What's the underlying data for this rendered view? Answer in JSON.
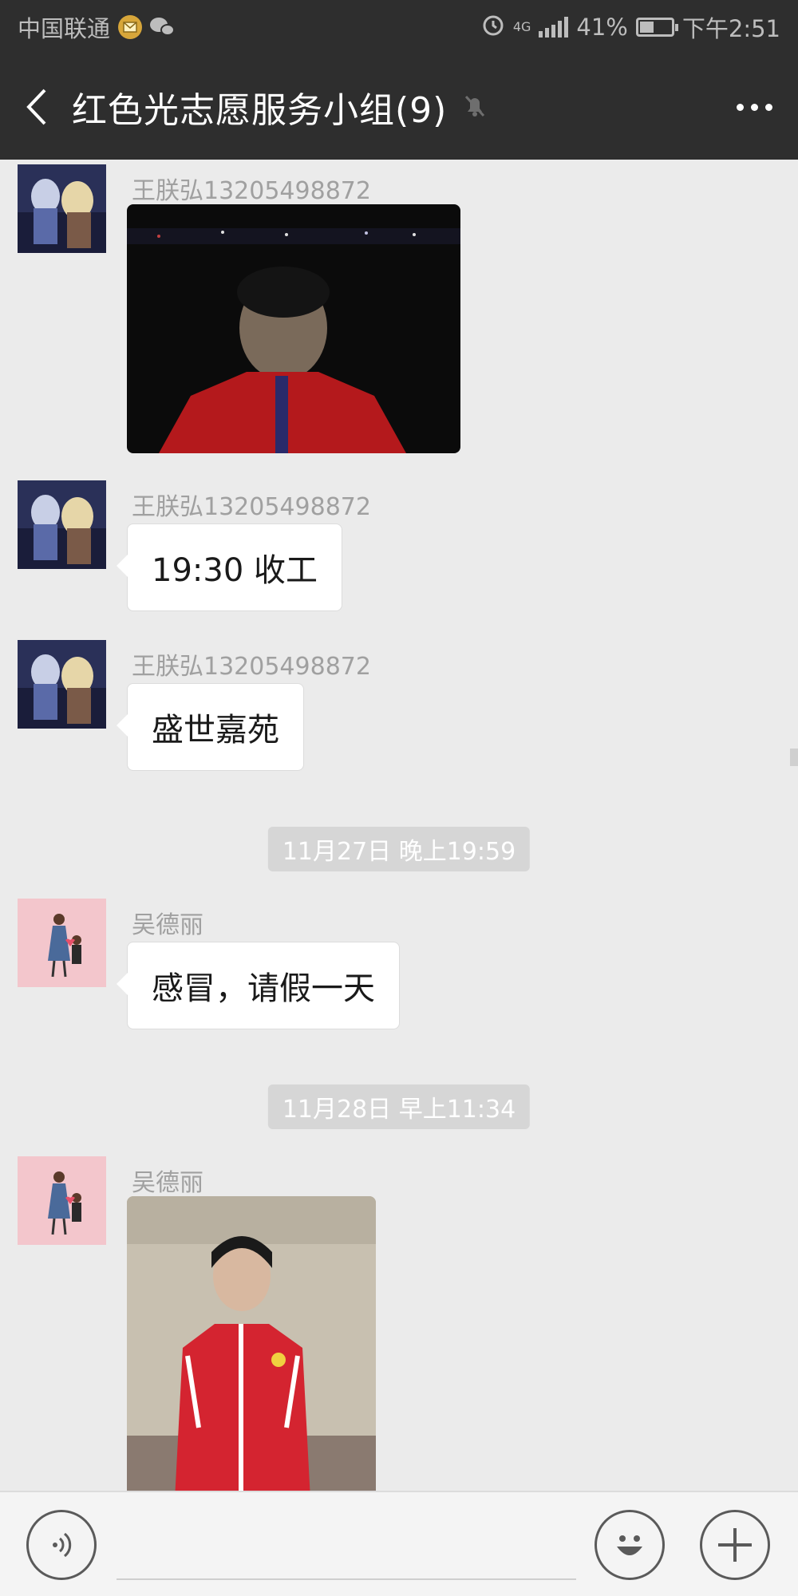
{
  "status_bar": {
    "carrier": "中国联通",
    "network": "4G",
    "battery_percent": "41%",
    "time": "下午2:51",
    "battery_level": 0.41
  },
  "header": {
    "title": "红色光志愿服务小组(9)",
    "back_icon": "chevron-left-icon",
    "mute_icon": "bell-muted-icon",
    "more_icon": "more-dots-icon"
  },
  "messages": [
    {
      "type": "image",
      "sender": "王朕弘13205498872",
      "image_desc": "photo"
    },
    {
      "type": "text",
      "sender": "王朕弘13205498872",
      "text": "19:30 收工"
    },
    {
      "type": "text",
      "sender": "王朕弘13205498872",
      "text": "盛世嘉苑"
    },
    {
      "type": "time",
      "text": "11月27日 晚上19:59"
    },
    {
      "type": "text",
      "sender": "吴德丽",
      "text": "感冒，请假一天"
    },
    {
      "type": "time",
      "text": "11月28日 早上11:34"
    },
    {
      "type": "image",
      "sender": "吴德丽",
      "image_desc": "photo"
    }
  ],
  "input_bar": {
    "voice_icon": "voice-icon",
    "emoji_icon": "emoji-icon",
    "plus_icon": "plus-icon",
    "placeholder": ""
  },
  "colors": {
    "header_bg": "#2e2e2e",
    "chat_bg": "#ebebeb",
    "bubble_bg": "#ffffff",
    "time_pill_bg": "#d6d6d6"
  }
}
